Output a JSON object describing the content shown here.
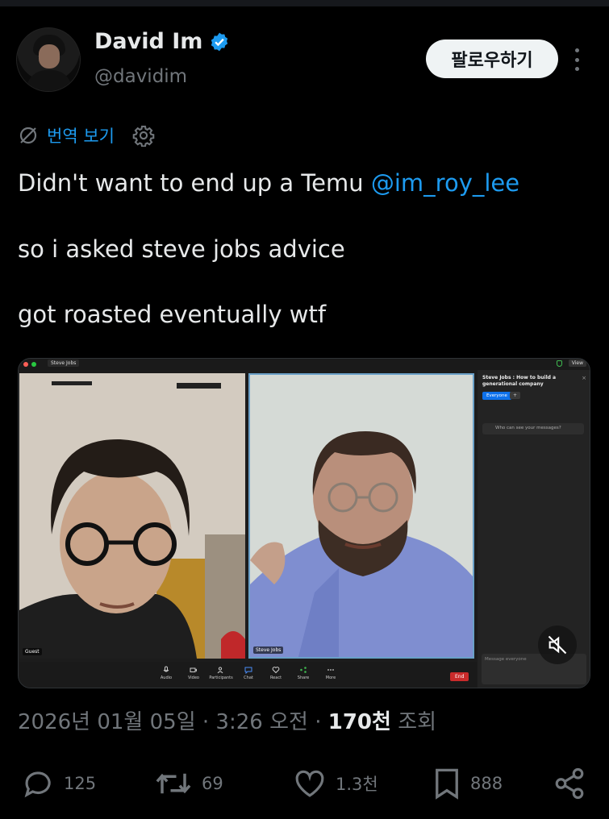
{
  "author": {
    "display_name": "David Im",
    "handle": "@davidim",
    "verified": true
  },
  "follow_label": "팔로우하기",
  "translate_label": "번역 보기",
  "tweet": {
    "line1_text": "Didn't want to end up a Temu ",
    "line1_mention": "@im_roy_lee",
    "line2": "so i asked steve jobs advice",
    "line3": "got roasted eventually wtf"
  },
  "media": {
    "window_title": "Steve Jobs",
    "view_label": "View",
    "left_tile_label": "Guest",
    "right_tile_label": "Steve Jobs",
    "chat_title": "Steve Jobs : How to build a generational company",
    "everyone_label": "Everyone",
    "plus_label": "+",
    "who_label": "Who can see your messages?",
    "message_placeholder": "Message everyone",
    "controls": [
      "Audio",
      "Video",
      "Participants",
      "Chat",
      "React",
      "Share",
      "More"
    ],
    "end_label": "End"
  },
  "meta": {
    "date": "2026년 01월 05일",
    "time": " · 3:26 오전",
    "sep": " · ",
    "views_count": "170천",
    "views_label": " 조회"
  },
  "stats": {
    "replies": "125",
    "reposts": "69",
    "likes": "1.3천",
    "bookmarks": "888"
  },
  "colors": {
    "accent": "#1d9bf0",
    "text": "#e7e9ea",
    "muted": "#71767b",
    "background": "#000000"
  }
}
